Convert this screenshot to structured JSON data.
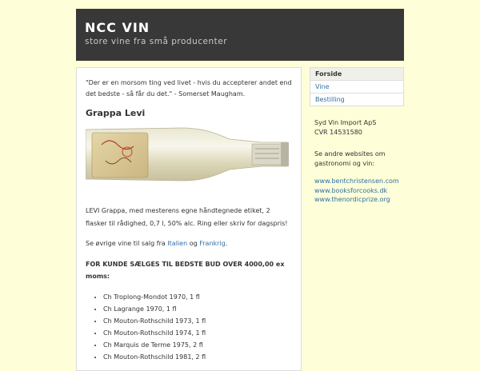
{
  "header": {
    "title": "NCC VIN",
    "tagline": "store vine fra små producenter"
  },
  "nav": [
    {
      "label": "Forside",
      "active": true
    },
    {
      "label": "Vine",
      "active": false
    },
    {
      "label": "Bestilling",
      "active": false
    }
  ],
  "sidebar": {
    "company": "Syd Vin Import ApS",
    "cvr": "CVR 14531580",
    "see_other": "Se andre websites om gastronomi og vin:",
    "links": [
      "www.bentchristensen.com",
      "www.booksforcooks.dk",
      "www.thenordicprize.org"
    ]
  },
  "main": {
    "quote": "\"Der er en morsom ting ved livet - hvis du accepterer andet end det bedste - så får du det.\" - Somerset Maugham.",
    "post_title": "Grappa Levi",
    "description": "LEVI Grappa, med mesterens egne håndtegnede etiket, 2 flasker til rådighed, 0,7 l, 50% alc. Ring eller skriv for dagspris!",
    "other_prefix": "Se øvrige vine til salg fra",
    "link_italy": "Italien",
    "other_and": "og",
    "link_france": "Frankrig",
    "other_suffix": ".",
    "auction_heading": "FOR KUNDE SÆLGES TIL BEDSTE BUD OVER 4000,00 ex moms:",
    "wines": [
      "Ch Troplong-Mondot 1970, 1 fl",
      "Ch Lagrange 1970, 1 fl",
      "Ch Mouton-Rothschild 1973, 1 fl",
      "Ch Mouton-Rothschild 1974, 1 fl",
      "Ch Marquis de Terme 1975, 2 fl",
      "Ch Mouton-Rothschild 1981, 2 fl"
    ]
  }
}
